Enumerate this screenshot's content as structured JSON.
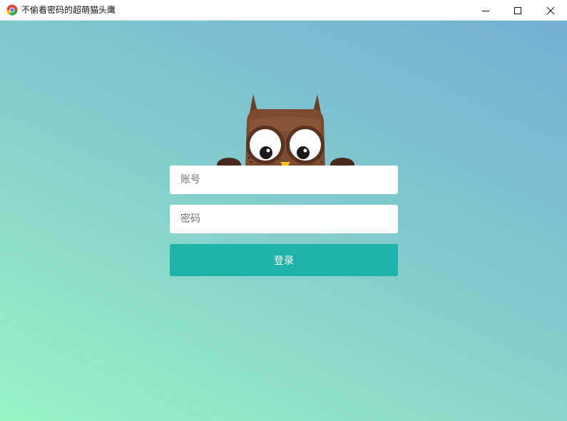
{
  "window": {
    "title": "不偷看密码的超萌猫头鹰"
  },
  "form": {
    "account_placeholder": "账号",
    "account_value": "",
    "password_placeholder": "密码",
    "password_value": "",
    "login_label": "登录"
  },
  "colors": {
    "gradient_top_right": "#73b0d3",
    "gradient_bottom_left": "#98f4c4",
    "button": "#1fb2ab",
    "owl_body": "#7a4a2e",
    "owl_hands": "#4a2a1f",
    "owl_beak": "#f5c518"
  },
  "icons": {
    "app": "chrome-like-app-icon",
    "minimize": "minimize-icon",
    "maximize": "maximize-icon",
    "close": "close-icon",
    "mascot": "owl-mascot"
  }
}
